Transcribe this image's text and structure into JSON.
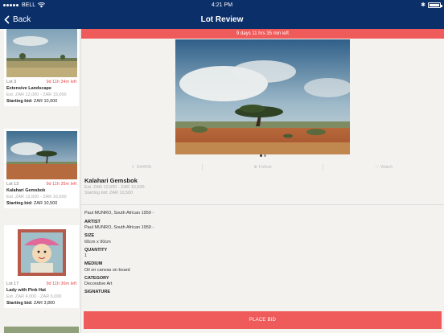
{
  "status": {
    "carrier": "BELL",
    "time": "4:21 PM",
    "battery_level": 1.0
  },
  "nav": {
    "back_label": "Back",
    "title": "Lot Review"
  },
  "sidebar": {
    "lots": [
      {
        "lot": "Lot 3",
        "time_left": "9d 11h 34m left",
        "title": "Extensive Landscape",
        "estimate": "Est. ZAR 12,000 - ZAR 15,000",
        "bid_label": "Starting bid:",
        "bid_value": "ZAR 10,000"
      },
      {
        "lot": "Lot 13",
        "time_left": "9d 11h 35m left",
        "title": "Kalahari Gemsbok",
        "estimate": "Est. ZAR 12,500 - ZAR 16,500",
        "bid_label": "Starting bid:",
        "bid_value": "ZAR 10,500"
      },
      {
        "lot": "Lot 17",
        "time_left": "9d 11h 36m left",
        "title": "Lady with Pink Hat",
        "estimate": "Est. ZAR 4,000 - ZAR 6,000",
        "bid_label": "Starting bid:",
        "bid_value": "ZAR 3,800"
      }
    ]
  },
  "main": {
    "timer": "9 days 11 hrs 35 min left",
    "actions": {
      "share": "SHARE",
      "follow": "Follow",
      "watch": "Watch"
    },
    "title": "Kalahari Gemsbok",
    "estimate": "Est. ZAR 12,500 - ZAR 16,500",
    "starting_bid": "Starting bid: ZAR 10,500",
    "intro": "Paul MUNRO, South African 1959 -",
    "details": [
      {
        "label": "ARTIST",
        "value": "Paul MUNRO, South African 1959 -"
      },
      {
        "label": "SIZE",
        "value": "60cm x 90cm"
      },
      {
        "label": "QUANTITY",
        "value": "1"
      },
      {
        "label": "MEDIUM",
        "value": "Oil on canvas on board"
      },
      {
        "label": "CATEGORY",
        "value": "Decorative Art"
      },
      {
        "label": "SIGNATURE",
        "value": ""
      }
    ],
    "place_bid": "PLACE BID"
  }
}
